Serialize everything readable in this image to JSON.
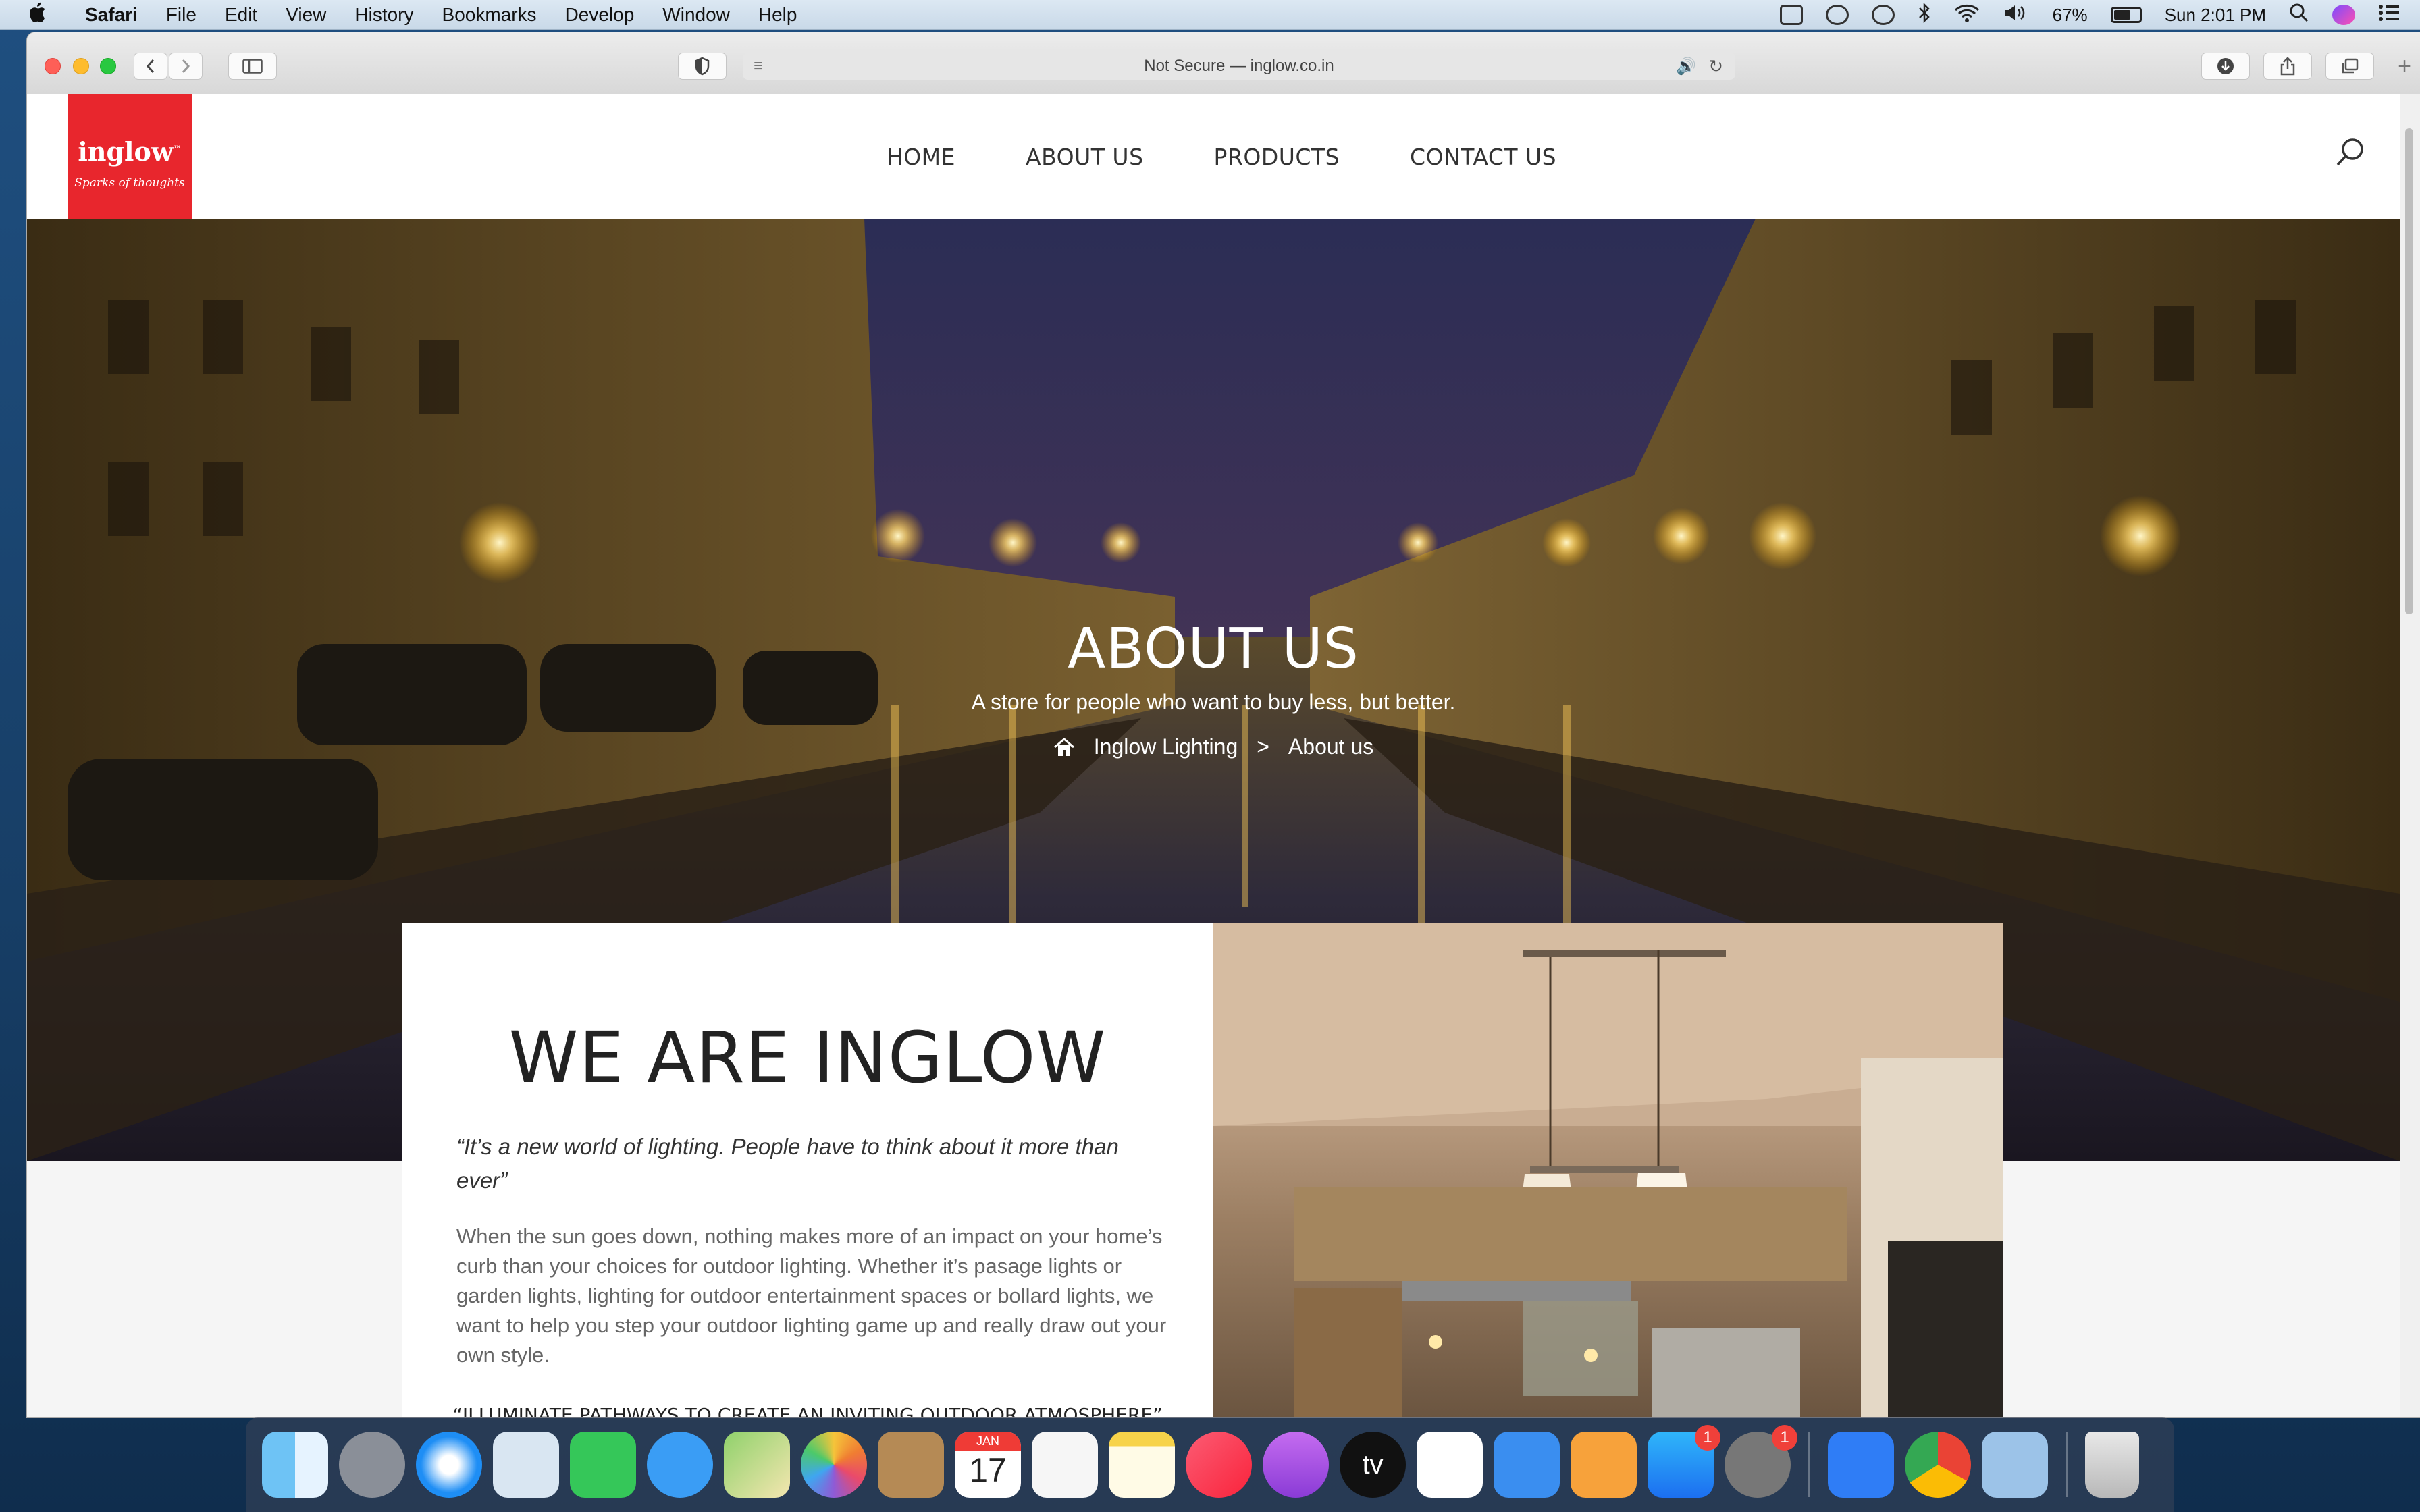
{
  "menubar": {
    "apple": "",
    "app_name": "Safari",
    "items": [
      "File",
      "Edit",
      "View",
      "History",
      "Bookmarks",
      "Develop",
      "Window",
      "Help"
    ],
    "battery_percent": "67%",
    "battery_level": 0.67,
    "clock": "Sun 2:01 PM"
  },
  "browser": {
    "address": "Not Secure — inglow.co.in"
  },
  "site": {
    "logo": {
      "name": "inglow",
      "tm": "™",
      "tagline": "Sparks of thoughts"
    },
    "nav": [
      "HOME",
      "ABOUT US",
      "PRODUCTS",
      "CONTACT US"
    ],
    "hero": {
      "title": "ABOUT US",
      "subtitle": "A store for people who want to buy less, but better.",
      "breadcrumb": {
        "home": "Inglow Lighting",
        "separator": ">",
        "current": "About us"
      }
    },
    "about": {
      "heading": "WE ARE INGLOW",
      "quote": "“It’s a new world of lighting. People have to think about it more than ever”",
      "body": "When the sun goes down, nothing makes more of an impact on your home’s curb than your choices for outdoor lighting. Whether it’s pasage lights or garden lights, lighting for outdoor entertainment spaces or bollard lights, we want to help you step your outdoor lighting game up and really draw out your own style.",
      "slogan": "“ILLUMINATE PATHWAYS TO CREATE AN INVITING OUTDOOR ATMOSPHERE”"
    }
  },
  "dock": {
    "apps": [
      "finder",
      "launchpad",
      "safari",
      "mail",
      "facetime",
      "messages",
      "maps",
      "photos",
      "contacts",
      "calendar",
      "reminders",
      "notes",
      "music",
      "podcasts",
      "tv",
      "numbers",
      "keynote",
      "pages",
      "app-store",
      "system-preferences",
      "xcode",
      "chrome",
      "preview"
    ],
    "calendar_month": "JAN",
    "calendar_day": "17",
    "tv_label": "tv",
    "app_store_badge": "1",
    "system_prefs_badge": "1"
  },
  "colors": {
    "brand_red": "#e8262d",
    "menubar": "#d4e2ef",
    "link_blue": "#2d7be5"
  }
}
